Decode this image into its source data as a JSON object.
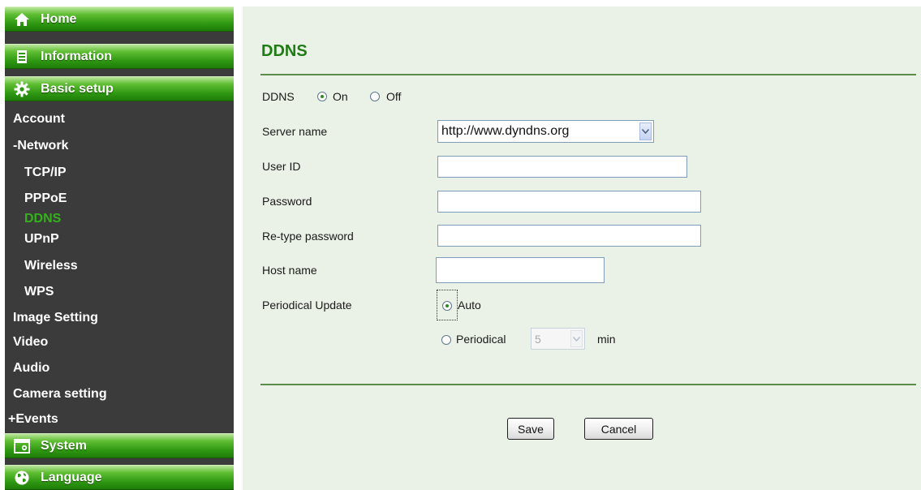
{
  "sidebar": {
    "sections": {
      "home": "Home",
      "information": "Information",
      "basic_setup": "Basic setup",
      "system": "System",
      "language": "Language"
    },
    "items": {
      "account": "Account",
      "network": "-Network",
      "tcpip": "TCP/IP",
      "pppoe": "PPPoE",
      "ddns": "DDNS",
      "upnp": "UPnP",
      "wireless": "Wireless",
      "wps": "WPS",
      "image_setting": "Image Setting",
      "video": "Video",
      "audio": "Audio",
      "camera_setting": "Camera setting",
      "events": "+Events"
    },
    "active_item": "DDNS",
    "icons": {
      "home": "home-icon",
      "information": "document-icon",
      "basic_setup": "gear-icon",
      "system": "system-icon",
      "language": "globe-icon"
    }
  },
  "form": {
    "title": "DDNS",
    "ddns_label": "DDNS",
    "ddns_on": "On",
    "ddns_off": "Off",
    "ddns_value": "On",
    "server_name_label": "Server name",
    "server_name_value": "http://www.dyndns.org",
    "user_id_label": "User ID",
    "user_id_value": "",
    "password_label": "Password",
    "password_value": "",
    "retype_password_label": "Re-type password",
    "retype_password_value": "",
    "host_name_label": "Host name",
    "host_name_value": "",
    "periodical_update_label": "Periodical Update",
    "auto_label": "Auto",
    "periodical_label": "Periodical",
    "periodical_update_value": "Auto",
    "period_value": "5",
    "period_unit": "min",
    "save_label": "Save",
    "cancel_label": "Cancel"
  },
  "colors": {
    "accent_green": "#2e9712",
    "title_green": "#1f7c14",
    "active_nav": "#33b21b",
    "sidebar_bg": "#3b3b3b",
    "content_bg": "#eaf1e6"
  }
}
